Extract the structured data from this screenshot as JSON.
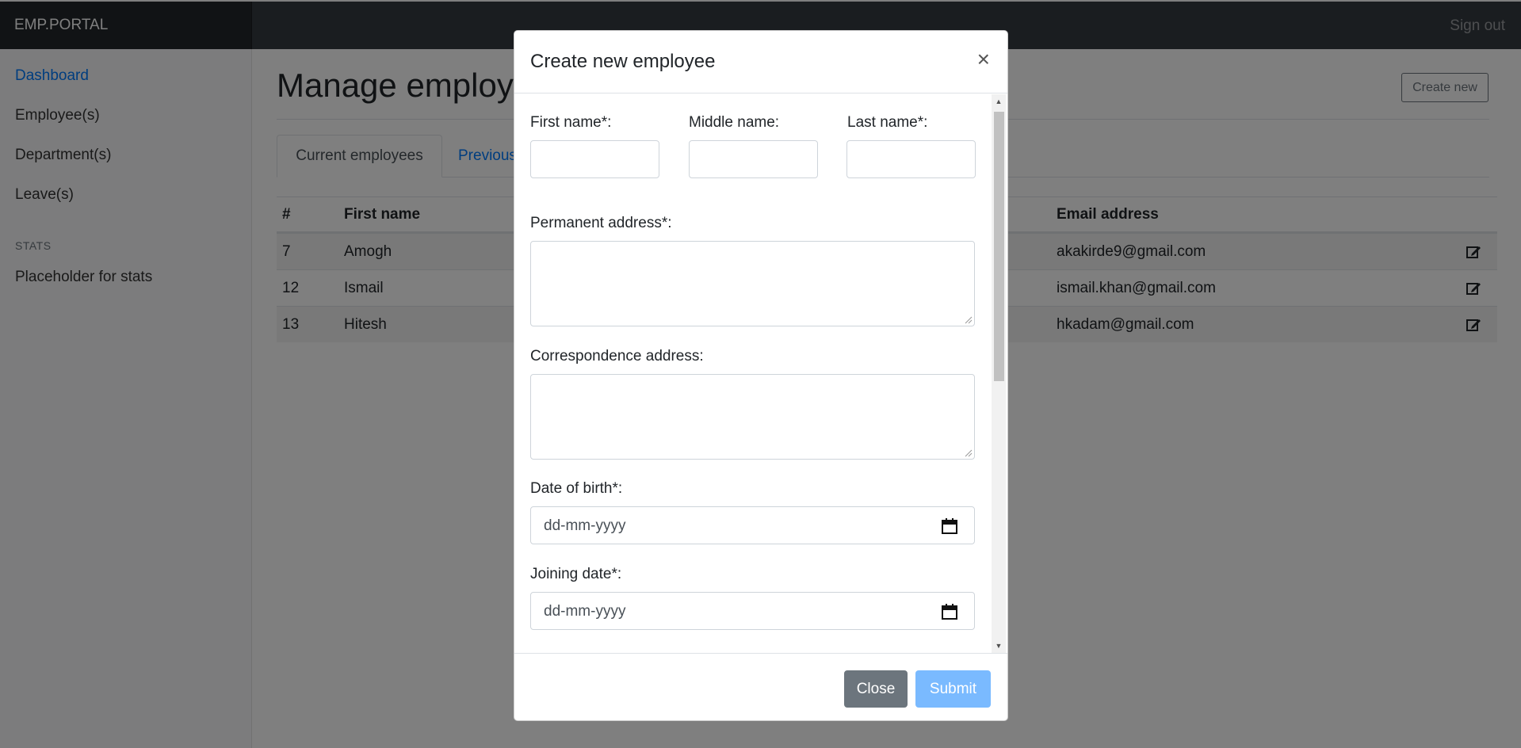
{
  "navbar": {
    "brand": "EMP.PORTAL",
    "signout": "Sign out"
  },
  "sidebar": {
    "items": [
      {
        "label": "Dashboard",
        "active": true
      },
      {
        "label": "Employee(s)",
        "active": false
      },
      {
        "label": "Department(s)",
        "active": false
      },
      {
        "label": "Leave(s)",
        "active": false
      }
    ],
    "stats_heading": "STATS",
    "stats_item": "Placeholder for stats"
  },
  "main": {
    "title": "Manage employees",
    "create_button": "Create new",
    "tabs": [
      {
        "label": "Current employees",
        "active": true
      },
      {
        "label": "Previous employees",
        "active": false
      }
    ],
    "table": {
      "headers": {
        "num": "#",
        "first_name": "First name",
        "email": "Email address"
      },
      "rows": [
        {
          "num": "7",
          "first_name": "Amogh",
          "email": "akakirde9@gmail.com"
        },
        {
          "num": "12",
          "first_name": "Ismail",
          "email": "ismail.khan@gmail.com"
        },
        {
          "num": "13",
          "first_name": "Hitesh",
          "email": "hkadam@gmail.com"
        }
      ]
    }
  },
  "modal": {
    "title": "Create new employee",
    "close_symbol": "×",
    "fields": {
      "first_name": {
        "label": "First name*:",
        "value": ""
      },
      "middle_name": {
        "label": "Middle name:",
        "value": ""
      },
      "last_name": {
        "label": "Last name*:",
        "value": ""
      },
      "permanent_address": {
        "label": "Permanent address*:",
        "value": ""
      },
      "correspondence_address": {
        "label": "Correspondence address:",
        "value": ""
      },
      "date_of_birth": {
        "label": "Date of birth*:",
        "placeholder": "dd-mm-yyyy"
      },
      "joining_date": {
        "label": "Joining date*:",
        "placeholder": "dd-mm-yyyy"
      }
    },
    "buttons": {
      "close": "Close",
      "submit": "Submit"
    }
  },
  "colors": {
    "navbar": "#343a40",
    "link": "#007bff",
    "submit": "#7abaff",
    "close": "#6c757d"
  },
  "icons": [
    "edit-icon",
    "calendar-icon",
    "close-icon",
    "scroll-up-arrow",
    "scroll-down-arrow"
  ]
}
